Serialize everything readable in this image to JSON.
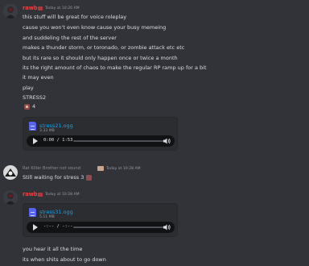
{
  "messages": [
    {
      "author": "rawb",
      "timestamp": "Today at 10:26 AM",
      "lines": [
        "this stuff will be great for voice roleplay",
        "cause you won't even know cause your busy memeing",
        "and suddeling the rest of the server",
        "makes a thunder storm, or toronado, or zombie attack etc etc",
        "but its rare so it should only happen once or twice a month",
        "its the right amount of chaos to make the regular RP ramp up for a bit",
        "it may even",
        "play",
        "STRESS2"
      ],
      "reaction_count": "4",
      "attachment": {
        "name": "stress21.ogg",
        "size": "3.33 MB",
        "time": "0:00 / 1:53"
      }
    },
    {
      "author": "Rat Killer Brother not sound",
      "timestamp": "Today at 10:28 AM",
      "lines": [
        "Still waiting for stress 3"
      ]
    },
    {
      "author": "rawb",
      "timestamp": "Today at 10:28 AM",
      "attachment": {
        "name": "stress31.ogg",
        "size": "5.11 MB",
        "time": "-:-- / -:--"
      },
      "lines_after": [
        "you hear it all the time",
        "its when shits about to go down"
      ]
    }
  ],
  "colors": {
    "background": "#313338",
    "author_red": "#f23f43",
    "link": "#00a8fc",
    "player": "#111214"
  },
  "icons": [
    "avatar",
    "role-tag-icon",
    "file-audio-icon",
    "play-icon",
    "volume-icon",
    "reaction-emoji"
  ]
}
